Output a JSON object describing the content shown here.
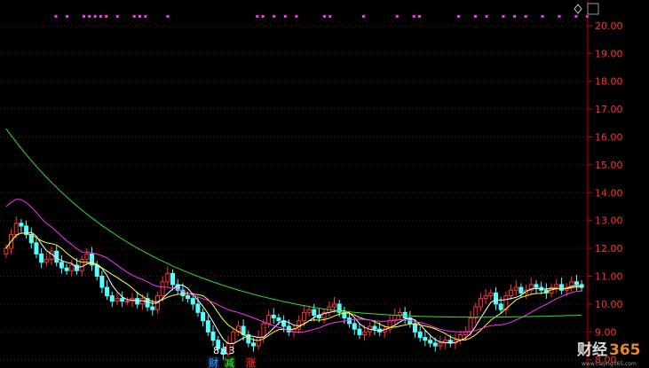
{
  "chart_data": {
    "type": "candlestick",
    "ylim": [
      7.8,
      20.6
    ],
    "y_ticks": [
      "20.00",
      "19.00",
      "18.00",
      "17.00",
      "16.00",
      "15.00",
      "14.00",
      "13.00",
      "12.00",
      "11.00",
      "10.00",
      "9.00",
      "8.00"
    ],
    "grid": true,
    "colors": {
      "up": "#ff3333",
      "down": "#54ffff",
      "ma_short": "#ffffff",
      "ma_mid": "#ffff33",
      "ma_long": "#ff33ff",
      "ma_longest": "#33dd33",
      "axis": "#cc0000",
      "grid": "#661111",
      "event_dots": "#ff33ff"
    },
    "close": [
      12.0,
      12.5,
      12.9,
      12.8,
      12.5,
      12.2,
      11.8,
      11.5,
      11.6,
      11.9,
      11.5,
      11.3,
      11.2,
      11.4,
      11.2,
      11.6,
      11.8,
      11.4,
      11.0,
      10.6,
      10.3,
      10.1,
      10.2,
      10.1,
      10.1,
      10.2,
      10.0,
      10.2,
      9.9,
      9.8,
      10.3,
      10.8,
      11.1,
      10.7,
      10.5,
      10.3,
      10.2,
      10.0,
      9.7,
      9.4,
      9.0,
      8.7,
      8.4,
      8.2,
      8.6,
      9.0,
      9.2,
      8.9,
      8.6,
      8.5,
      8.8,
      9.3,
      9.6,
      9.5,
      9.4,
      9.2,
      9.0,
      9.1,
      9.4,
      9.7,
      9.8,
      9.6,
      9.5,
      9.7,
      9.9,
      10.0,
      9.7,
      9.5,
      9.3,
      9.1,
      8.9,
      9.0,
      9.2,
      9.1,
      9.0,
      9.1,
      9.4,
      9.6,
      9.7,
      9.5,
      9.3,
      9.0,
      8.8,
      8.7,
      8.6,
      8.5,
      8.6,
      8.7,
      8.6,
      8.7,
      8.9,
      9.0,
      9.5,
      9.9,
      10.2,
      10.3,
      10.4,
      10.0,
      9.8,
      10.3,
      10.5,
      10.6,
      10.4,
      10.5,
      10.7,
      10.6,
      10.5,
      10.4,
      10.6,
      10.7,
      10.5,
      10.6,
      10.8,
      10.7,
      10.6
    ],
    "ma_longest_start": 16.3,
    "ma_longest_end": 9.5,
    "event_dots_x_fraction": [
      0.05,
      0.07,
      0.1,
      0.11,
      0.12,
      0.13,
      0.14,
      0.16,
      0.19,
      0.2,
      0.21,
      0.25,
      0.41,
      0.42,
      0.44,
      0.46,
      0.48,
      0.53,
      0.54,
      0.6,
      0.66,
      0.69,
      0.7,
      0.77,
      0.8,
      0.82,
      0.85,
      0.87,
      0.89,
      0.92,
      0.95,
      0.98,
      1.0
    ],
    "low_marker": "8.13",
    "event_labels": [
      {
        "text": "财",
        "color": "#33aaff"
      },
      {
        "text": "减",
        "color": "#33ff33"
      },
      {
        "text": "涨",
        "color": "#ff3333"
      }
    ]
  },
  "watermark": {
    "brand_a": "财经",
    "brand_b": "365",
    "url": "www.caijing365.com"
  }
}
